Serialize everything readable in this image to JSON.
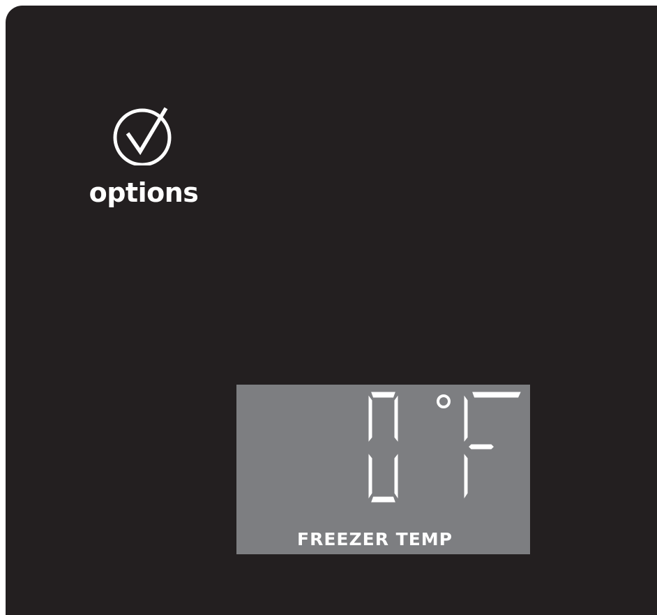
{
  "options": {
    "label": "options",
    "icon": "checkmark-circle-icon"
  },
  "freezer_display": {
    "value": "0",
    "unit_symbol": "°",
    "unit_letter": "F",
    "label": "FREEZER TEMP",
    "segment_color": "#ffffff",
    "background_color": "#7d7e81"
  },
  "colors": {
    "panel": "#231f20",
    "text": "#ffffff"
  }
}
